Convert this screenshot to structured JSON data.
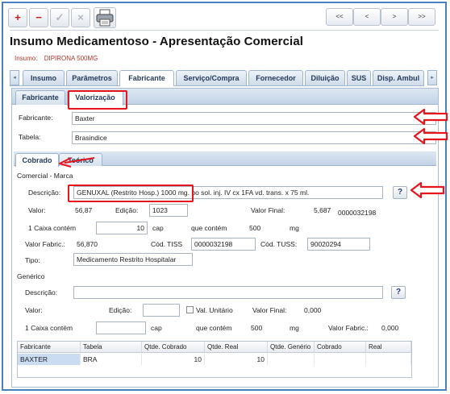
{
  "toolbar": {
    "add": "+",
    "remove": "−",
    "confirm": "✓",
    "cancel": "×",
    "first": "<<",
    "prev": "<",
    "next": ">",
    "last": ">>"
  },
  "page_title": "Insumo Medicamentoso - Apresentação Comercial",
  "insumo": {
    "label": "Insumo:",
    "value": "DIPIRONA 500MG"
  },
  "tabs": [
    "Insumo",
    "Parâmetros",
    "Fabricante",
    "Serviço/Compra",
    "Fornecedor",
    "Diluição",
    "SUS",
    "Disp. Ambul"
  ],
  "subtabs": [
    "Fabricante",
    "Valorização"
  ],
  "fabricante_field": {
    "label": "Fabricante:",
    "value": "Baxter"
  },
  "tabela_field": {
    "label": "Tabela:",
    "value": "Brasindice"
  },
  "inner_tabs": [
    "Cobrado",
    "Teórico"
  ],
  "comercial": {
    "section": "Comercial - Marca",
    "descricao_label": "Descrição:",
    "descricao": "GENUXAL (Restrito Hosp.) 1000 mg. po sol. inj. IV cx 1FA vd. trans. x 75 ml.",
    "valor_label": "Valor:",
    "valor": "56,87",
    "edicao_label": "Edição:",
    "edicao": "1023",
    "valor_final_label": "Valor Final:",
    "valor_final": "5,687",
    "codigo": "0000032198",
    "caixa_label": "1 Caixa contém",
    "caixa": "10",
    "cap": "cap",
    "que_contem": "que contém",
    "contem_valor": "500",
    "mg": "mg",
    "valor_fabric_label": "Valor Fabric.:",
    "valor_fabric": "56,870",
    "cod_tiss_label": "Cód. TISS",
    "cod_tiss": "0000032198",
    "cod_tuss_label": "Cód. TUSS:",
    "cod_tuss": "90020294",
    "tipo_label": "Tipo:",
    "tipo": "Medicamento Restrito Hospitalar"
  },
  "generico": {
    "section": "Genérico",
    "descricao_label": "Descrição:",
    "descricao": "",
    "valor_label": "Valor:",
    "edicao_label": "Edição:",
    "edicao": "",
    "val_unitario": "Val. Unitário",
    "valor_final_label": "Valor Final:",
    "valor_final": "0,000",
    "caixa_label": "1 Caixa contém",
    "caixa": "",
    "cap": "cap",
    "que_contem": "que contém",
    "contem_valor": "500",
    "mg": "mg",
    "valor_fabric_label": "Valor Fabric.:",
    "valor_fabric": "0,000"
  },
  "help_button": "?",
  "grid": {
    "columns": [
      "Fabricante",
      "Tabela",
      "Qtde. Cobrado",
      "Qtde. Real",
      "Qtde. Genério",
      "Cobrado",
      "Real"
    ],
    "rows": [
      [
        "BAXTER",
        "BRA",
        "10",
        "10",
        "",
        "",
        ""
      ]
    ]
  },
  "colors": {
    "window_border": "#4a7fc0",
    "annotation": "#e8141b",
    "insumo_text": "#b4372a",
    "tab_text": "#233a5c"
  }
}
